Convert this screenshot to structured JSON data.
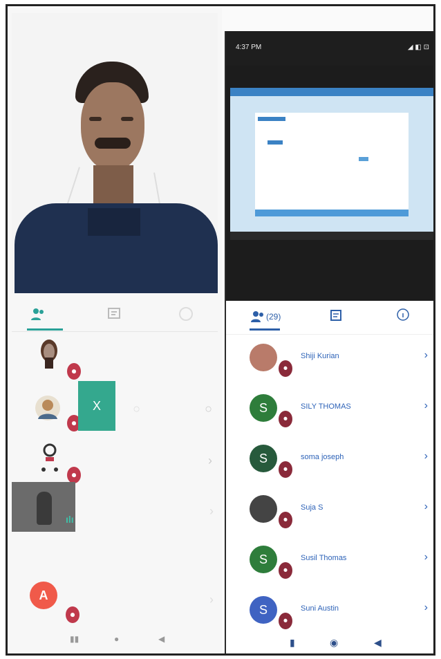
{
  "status_bar": {
    "time": "4:37 PM",
    "right_icons": "◢ ◧ ⊡"
  },
  "left_panel": {
    "tabs": [
      {
        "icon": "participants-icon"
      },
      {
        "icon": "chat-icon"
      },
      {
        "icon": "info-icon"
      }
    ],
    "tile_label": "X",
    "section_label": ""
  },
  "right_panel": {
    "tabs": {
      "participants_count": "(29)"
    },
    "participants": [
      {
        "name": "Shiji Kurian",
        "initial": "",
        "color": "#b97b6a"
      },
      {
        "name": "SILY THOMAS",
        "initial": "S",
        "color": "#2e7d3b"
      },
      {
        "name": "soma joseph",
        "initial": "S",
        "color": "#275a3c"
      },
      {
        "name": "Suja S",
        "initial": "",
        "color": "#444444"
      },
      {
        "name": "Susil Thomas",
        "initial": "S",
        "color": "#2e7d3b"
      },
      {
        "name": "Suni Austin",
        "initial": "S",
        "color": "#3f63c2"
      }
    ]
  },
  "left_avatar_initial": "A",
  "colors": {
    "accent_left": "#2aa198",
    "accent_right": "#2d5fa8",
    "mic_muted": "#c0394c"
  }
}
